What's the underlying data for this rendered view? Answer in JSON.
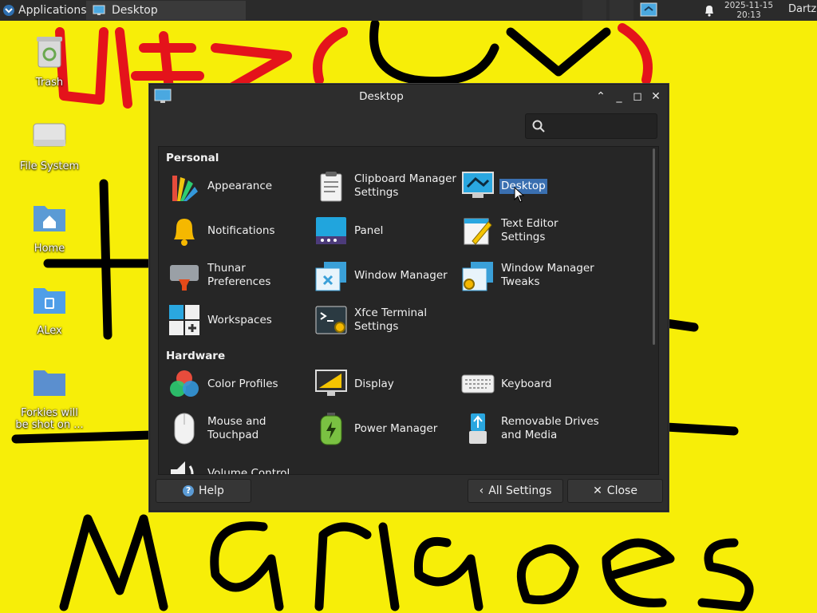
{
  "panel": {
    "applications_label": "Applications",
    "task_label": "Desktop",
    "clock_date": "2025-11-15",
    "clock_time": "20:13",
    "user": "Dartz"
  },
  "desktop_icons": [
    {
      "label": "Trash"
    },
    {
      "label": "File System"
    },
    {
      "label": "Home"
    },
    {
      "label": "ALex"
    },
    {
      "label": "Forkies will be shot on ..."
    }
  ],
  "dialog": {
    "title": "Desktop",
    "search_placeholder": "",
    "sections": {
      "personal": "Personal",
      "hardware": "Hardware"
    },
    "items": {
      "appearance": "Appearance",
      "clipboard": "Clipboard Manager Settings",
      "desktop": "Desktop",
      "notifications": "Notifications",
      "panel": "Panel",
      "text_editor": "Text Editor Settings",
      "thunar": "Thunar Preferences",
      "window_manager": "Window Manager",
      "wm_tweaks": "Window Manager Tweaks",
      "workspaces": "Workspaces",
      "xfce_terminal": "Xfce Terminal Settings",
      "color_profiles": "Color Profiles",
      "display": "Display",
      "keyboard": "Keyboard",
      "mouse": "Mouse and Touchpad",
      "power": "Power Manager",
      "removable": "Removable Drives and Media",
      "volume": "Volume Control"
    },
    "buttons": {
      "help": "Help",
      "all_settings": "All Settings",
      "close": "Close"
    }
  },
  "colors": {
    "wallpaper": "#f7ee08",
    "scribble_black": "#000000",
    "scribble_red": "#e4131b",
    "selection": "#3a6fb0"
  }
}
